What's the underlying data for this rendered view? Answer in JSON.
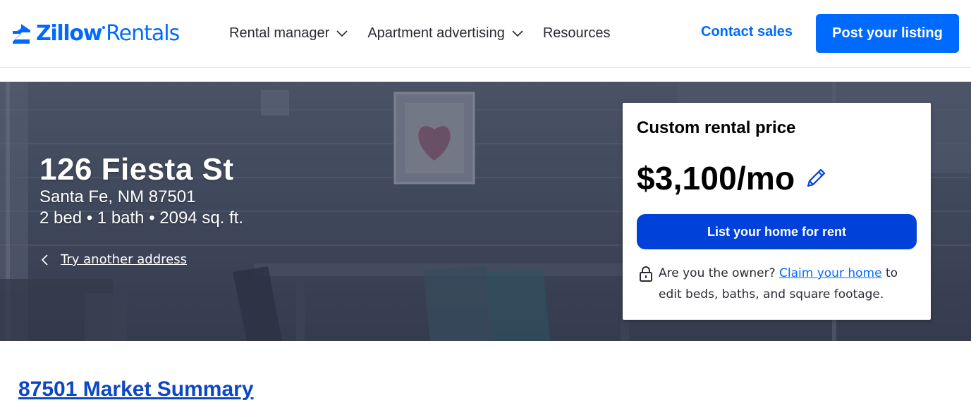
{
  "header": {
    "logo": {
      "brand_bold": "Zillow",
      "brand_regular": "Rentals"
    },
    "nav": [
      {
        "label": "Rental manager",
        "has_dropdown": true
      },
      {
        "label": "Apartment advertising",
        "has_dropdown": true
      },
      {
        "label": "Resources",
        "has_dropdown": false
      }
    ],
    "contact_sales_label": "Contact sales",
    "post_listing_label": "Post your listing"
  },
  "hero": {
    "address": "126 Fiesta St",
    "city_state_zip": "Santa Fe, NM 87501",
    "specs": "2 bed • 1 bath • 2094 sq. ft.",
    "try_another_label": "Try another address"
  },
  "price_card": {
    "title": "Custom rental price",
    "price": "$3,100/mo",
    "list_button_label": "List your home for rent",
    "owner_prompt": "Are you the owner?",
    "claim_link_label": "Claim your home",
    "owner_suffix": "to edit beds, baths, and square footage."
  },
  "market_summary_label": "87501 Market Summary",
  "colors": {
    "brand_blue": "#006aff",
    "button_dark_blue": "#0041d9",
    "link_blue": "#0d47c4",
    "hero_overlay": "#4c5569"
  },
  "icons": {
    "logo": "zillow-z-icon",
    "nav_dropdown": "chevron-down-icon",
    "back": "chevron-left-icon",
    "edit": "pencil-icon",
    "lock": "lock-icon"
  }
}
